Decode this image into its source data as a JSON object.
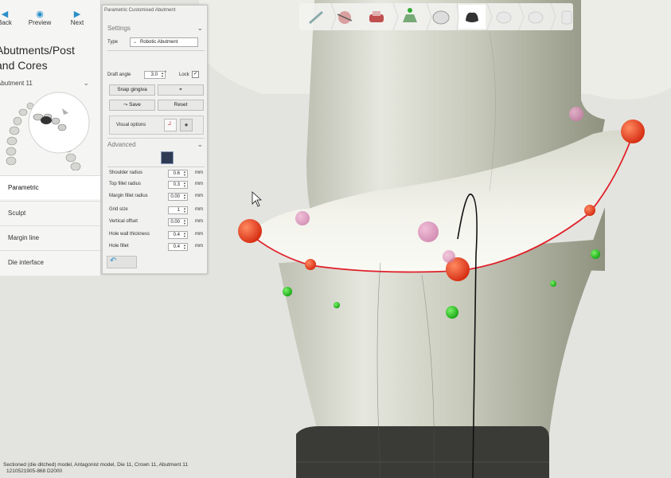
{
  "nav": {
    "back": "Back",
    "preview": "Preview",
    "next": "Next"
  },
  "workflow_title_line1": "Abutments/Post",
  "workflow_title_line2": "and Cores",
  "selected_item": "Abutment 11",
  "steps": [
    "Parametric",
    "Sculpt",
    "Margin line",
    "Die interface"
  ],
  "dialog": {
    "title": "Parametric Customised Abutment",
    "settings_header": "Settings",
    "type_label": "Type",
    "type_value": "Robotic Abutment",
    "draft_angle_label": "Draft angle",
    "draft_angle_value": "3.0",
    "draft_angle_unit": "°",
    "lock_label": "Lock",
    "snap_gingiva": "Snap gingiva",
    "save": "Save",
    "reset": "Reset",
    "visual_options": "Visual options",
    "advanced_header": "Advanced",
    "params": [
      {
        "label": "Shoulder radius",
        "value": "0.6",
        "unit": "mm"
      },
      {
        "label": "Top fillet radius",
        "value": "0.3",
        "unit": "mm"
      },
      {
        "label": "Margin fillet radius",
        "value": "0.00",
        "unit": "mm"
      },
      {
        "label": "Grid size",
        "value": "1",
        "unit": "mm"
      },
      {
        "label": "Vertical offset",
        "value": "0.00",
        "unit": "mm"
      },
      {
        "label": "Hole wall thickness",
        "value": "0.4",
        "unit": "mm"
      },
      {
        "label": "Hole fillet",
        "value": "0.4",
        "unit": "mm"
      }
    ]
  },
  "status_line1": "Sectioned (die ditched) model, Antagonist model, Die 11, Crown 11, Abutment 11",
  "status_line2": "1210521905-868 D2000",
  "icons": [
    "back-arrow-icon",
    "eye-icon",
    "next-arrow-icon",
    "chevron-down-icon",
    "undo-icon",
    "mouse-cursor-icon"
  ],
  "colors": {
    "accent": "#2a8fc8",
    "margin_line": "#e0202a",
    "control_point_red": "#e8381c",
    "control_point_green": "#22c41c",
    "control_point_pink": "#d88ab8"
  }
}
